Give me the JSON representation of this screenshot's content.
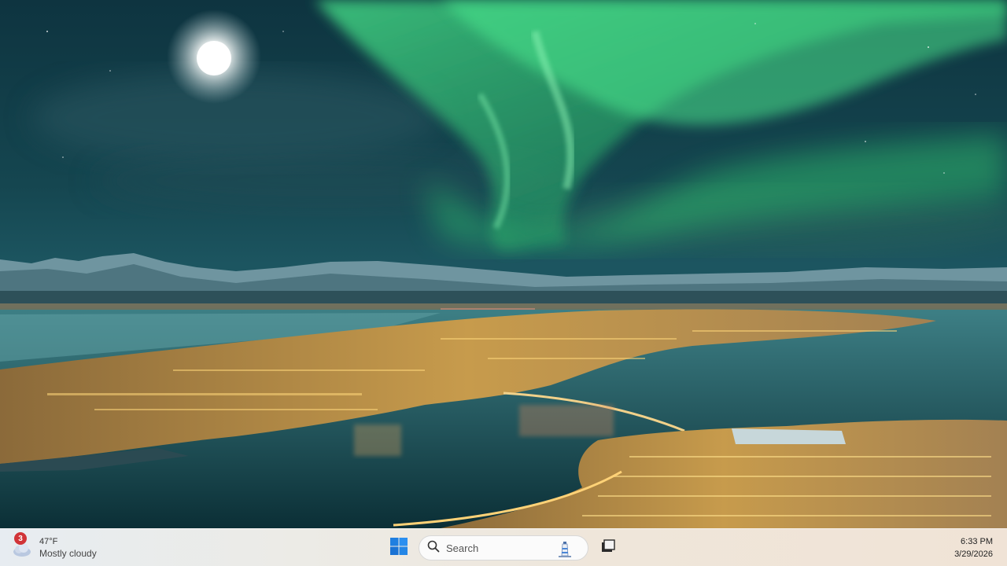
{
  "desktop": {
    "wallpaper": "aurora-over-city-at-night"
  },
  "taskbar": {
    "weather": {
      "icon": "cloudy-weather-icon",
      "badge_count": "3",
      "temperature": "47°F",
      "condition": "Mostly cloudy"
    },
    "start_icon": "windows-logo-icon",
    "search": {
      "icon": "search-icon",
      "placeholder": "Search",
      "highlight_icon": "lighthouse-icon"
    },
    "task_view_icon": "task-view-icon",
    "clock": {
      "time": "6:33 PM",
      "date": "3/29/2026"
    }
  },
  "colors": {
    "aurora": "#35d07a",
    "sky": "#0f3a45",
    "city_lights": "#f2c65a",
    "water": "#0d3b44",
    "windows_blue": "#1f7fe0",
    "badge_red": "#d13438"
  }
}
